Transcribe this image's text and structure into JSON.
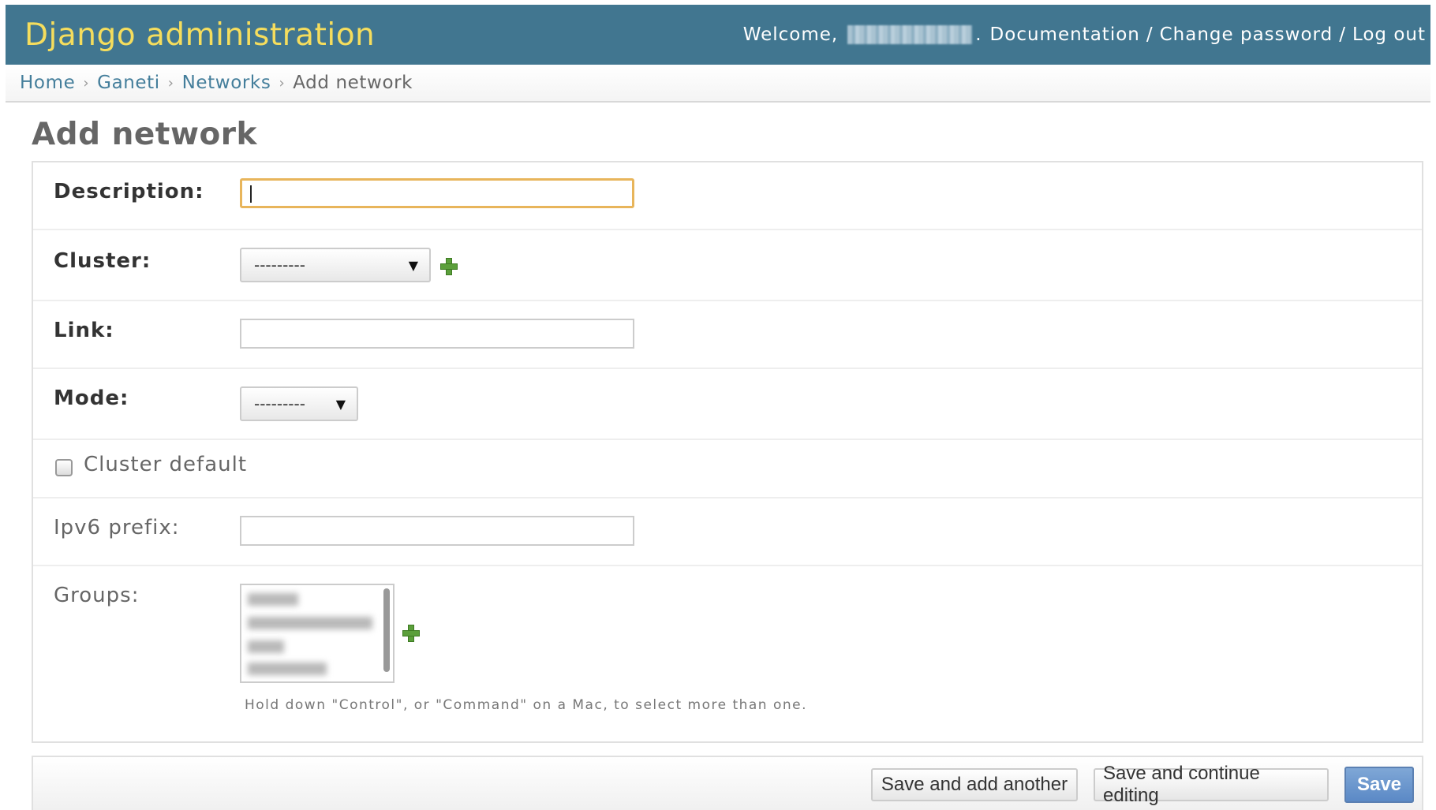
{
  "header": {
    "branding": "Django administration",
    "welcome": "Welcome,",
    "username_redacted": ".",
    "links": [
      "Documentation",
      "Change password",
      "Log out"
    ],
    "separator": "/"
  },
  "breadcrumbs": {
    "items": [
      "Home",
      "Ganeti",
      "Networks"
    ],
    "current": "Add network",
    "chevron": "›"
  },
  "page_title": "Add network",
  "form": {
    "description": {
      "label": "Description:",
      "value": ""
    },
    "cluster": {
      "label": "Cluster:",
      "selected": "---------"
    },
    "link": {
      "label": "Link:",
      "value": ""
    },
    "mode": {
      "label": "Mode:",
      "selected": "---------"
    },
    "cluster_default": {
      "label": "Cluster default",
      "checked": false
    },
    "ipv6_prefix": {
      "label": "Ipv6 prefix:",
      "value": ""
    },
    "groups": {
      "label": "Groups:",
      "help": "Hold down \"Control\", or \"Command\" on a Mac, to select more than one."
    }
  },
  "submit": {
    "save_add_another": "Save and add another",
    "save_continue": "Save and continue editing",
    "save": "Save"
  },
  "icons": {
    "add": "add-related-icon",
    "dropdown": "chevron-down-icon"
  },
  "colors": {
    "header_bg": "#417690",
    "branding": "#f5dd5d",
    "link": "#447e9b",
    "focus_border": "#e8b55b",
    "save_button": "#5b89c6",
    "add_icon": "#5b9f3b"
  }
}
